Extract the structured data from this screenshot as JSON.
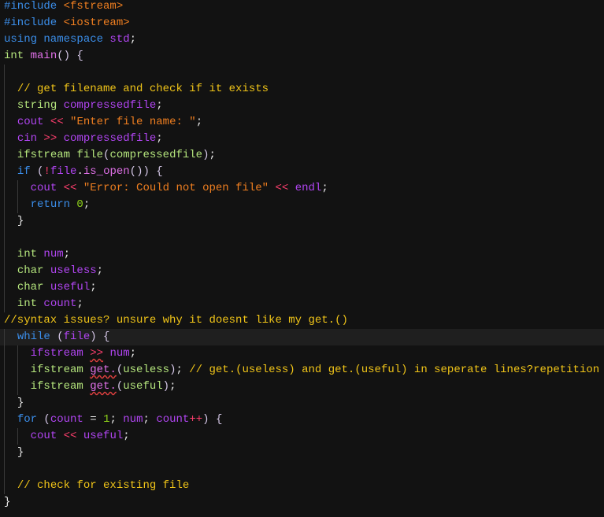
{
  "editor": {
    "language": "cpp",
    "current_line": 20,
    "lines": [
      {
        "indent": 0,
        "tokens": [
          [
            "kw-blue",
            "#include "
          ],
          [
            "str",
            "<fstream>"
          ]
        ]
      },
      {
        "indent": 0,
        "tokens": [
          [
            "kw-blue",
            "#include "
          ],
          [
            "str",
            "<iostream>"
          ]
        ]
      },
      {
        "indent": 0,
        "tokens": [
          [
            "kw-blue",
            "using namespace "
          ],
          [
            "ident",
            "std"
          ],
          [
            "punc",
            ";"
          ]
        ]
      },
      {
        "indent": 0,
        "tokens": [
          [
            "kw-green",
            "int "
          ],
          [
            "fn",
            "main"
          ],
          [
            "paren",
            "() {"
          ]
        ]
      },
      {
        "indent": 0,
        "tokens": []
      },
      {
        "indent": 2,
        "tokens": [
          [
            "comment",
            "// get filename and check if it exists"
          ]
        ]
      },
      {
        "indent": 2,
        "tokens": [
          [
            "kw-green",
            "string "
          ],
          [
            "ident",
            "compressedfile"
          ],
          [
            "punc",
            ";"
          ]
        ]
      },
      {
        "indent": 2,
        "tokens": [
          [
            "ident",
            "cout "
          ],
          [
            "op",
            "<< "
          ],
          [
            "str",
            "\"Enter file name: \""
          ],
          [
            "punc",
            ";"
          ]
        ]
      },
      {
        "indent": 2,
        "tokens": [
          [
            "ident",
            "cin "
          ],
          [
            "op",
            ">> "
          ],
          [
            "ident",
            "compressedfile"
          ],
          [
            "punc",
            ";"
          ]
        ]
      },
      {
        "indent": 2,
        "tokens": [
          [
            "kw-green",
            "ifstream "
          ],
          [
            "plain",
            "file"
          ],
          [
            "paren",
            "("
          ],
          [
            "plain",
            "compressedfile"
          ],
          [
            "paren",
            ")"
          ],
          [
            "punc",
            ";"
          ]
        ]
      },
      {
        "indent": 2,
        "tokens": [
          [
            "kw-blue",
            "if "
          ],
          [
            "paren",
            "("
          ],
          [
            "op",
            "!"
          ],
          [
            "ident",
            "file"
          ],
          [
            "punc",
            "."
          ],
          [
            "fn",
            "is_open"
          ],
          [
            "paren",
            "()) {"
          ]
        ]
      },
      {
        "indent": 4,
        "tokens": [
          [
            "ident",
            "cout "
          ],
          [
            "op",
            "<< "
          ],
          [
            "str",
            "\"Error: Could not open file\" "
          ],
          [
            "op",
            "<< "
          ],
          [
            "ident",
            "endl"
          ],
          [
            "punc",
            ";"
          ]
        ]
      },
      {
        "indent": 4,
        "tokens": [
          [
            "kw-blue",
            "return "
          ],
          [
            "num",
            "0"
          ],
          [
            "punc",
            ";"
          ]
        ]
      },
      {
        "indent": 2,
        "tokens": [
          [
            "punc",
            "}"
          ]
        ]
      },
      {
        "indent": 0,
        "tokens": []
      },
      {
        "indent": 2,
        "tokens": [
          [
            "kw-green",
            "int "
          ],
          [
            "ident",
            "num"
          ],
          [
            "punc",
            ";"
          ]
        ]
      },
      {
        "indent": 2,
        "tokens": [
          [
            "kw-green",
            "char "
          ],
          [
            "ident",
            "useless"
          ],
          [
            "punc",
            ";"
          ]
        ]
      },
      {
        "indent": 2,
        "tokens": [
          [
            "kw-green",
            "char "
          ],
          [
            "ident",
            "useful"
          ],
          [
            "punc",
            ";"
          ]
        ]
      },
      {
        "indent": 2,
        "tokens": [
          [
            "kw-green",
            "int "
          ],
          [
            "ident",
            "count"
          ],
          [
            "punc",
            ";"
          ]
        ]
      },
      {
        "indent": 0,
        "tokens": [
          [
            "comment",
            "//syntax issues? unsure why it doesnt like my get.()"
          ]
        ]
      },
      {
        "indent": 2,
        "tokens": [
          [
            "kw-blue",
            "while "
          ],
          [
            "paren",
            "("
          ],
          [
            "ident",
            "file"
          ],
          [
            "paren",
            ") {"
          ]
        ]
      },
      {
        "indent": 4,
        "tokens": [
          [
            "ident",
            "ifstream "
          ],
          [
            "op squiggle",
            ">>"
          ],
          [
            "punc",
            " "
          ],
          [
            "ident",
            "num"
          ],
          [
            "punc",
            ";"
          ]
        ]
      },
      {
        "indent": 4,
        "tokens": [
          [
            "kw-green",
            "ifstream "
          ],
          [
            "fn squiggle",
            "get."
          ],
          [
            "paren",
            "("
          ],
          [
            "plain",
            "useless"
          ],
          [
            "paren",
            ")"
          ],
          [
            "punc",
            "; "
          ],
          [
            "comment",
            "// get.(useless) and get.(useful) in seperate lines?repetition"
          ]
        ]
      },
      {
        "indent": 4,
        "tokens": [
          [
            "kw-green",
            "ifstream "
          ],
          [
            "fn squiggle",
            "get."
          ],
          [
            "paren",
            "("
          ],
          [
            "plain",
            "useful"
          ],
          [
            "paren",
            ")"
          ],
          [
            "punc",
            ";"
          ]
        ]
      },
      {
        "indent": 2,
        "tokens": [
          [
            "punc",
            "}"
          ]
        ]
      },
      {
        "indent": 2,
        "tokens": [
          [
            "kw-blue",
            "for "
          ],
          [
            "paren",
            "("
          ],
          [
            "ident",
            "count "
          ],
          [
            "punc",
            "= "
          ],
          [
            "num",
            "1"
          ],
          [
            "punc",
            "; "
          ],
          [
            "ident",
            "num"
          ],
          [
            "punc",
            "; "
          ],
          [
            "ident",
            "count"
          ],
          [
            "op",
            "++"
          ],
          [
            "paren",
            ") {"
          ]
        ]
      },
      {
        "indent": 4,
        "tokens": [
          [
            "ident",
            "cout "
          ],
          [
            "op",
            "<< "
          ],
          [
            "ident",
            "useful"
          ],
          [
            "punc",
            ";"
          ]
        ]
      },
      {
        "indent": 2,
        "tokens": [
          [
            "punc",
            "}"
          ]
        ]
      },
      {
        "indent": 0,
        "tokens": []
      },
      {
        "indent": 2,
        "tokens": [
          [
            "comment",
            "// check for existing file"
          ]
        ]
      },
      {
        "indent": 0,
        "tokens": [
          [
            "punc",
            "}"
          ]
        ]
      }
    ]
  }
}
